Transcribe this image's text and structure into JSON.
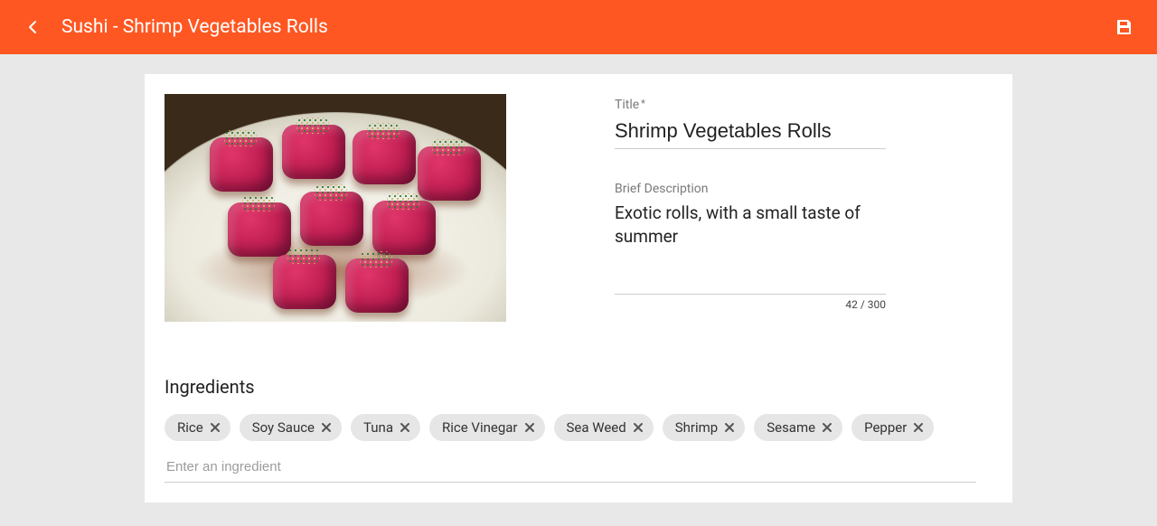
{
  "header": {
    "title": "Sushi - Shrimp Vegetables Rolls"
  },
  "form": {
    "title_label": "Title",
    "title_required_mark": "*",
    "title_value": "Shrimp Vegetables Rolls",
    "desc_label": "Brief Description",
    "desc_value": "Exotic rolls, with a small taste of summer",
    "desc_counter": "42 / 300"
  },
  "ingredients": {
    "heading": "Ingredients",
    "placeholder": "Enter an ingredient",
    "items": [
      "Rice",
      "Soy Sauce",
      "Tuna",
      "Rice Vinegar",
      "Sea Weed",
      "Shrimp",
      "Sesame",
      "Pepper"
    ]
  }
}
